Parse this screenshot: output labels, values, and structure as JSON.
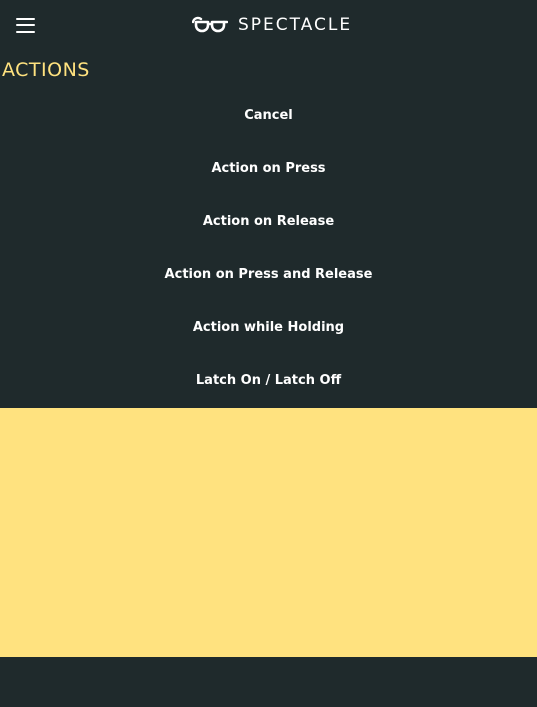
{
  "header": {
    "menu_icon": "hamburger-menu-icon",
    "logo_icon": "glasses-icon",
    "brand_name": "SPECTACLE"
  },
  "section": {
    "title": "ACTIONS"
  },
  "actions": [
    {
      "label": "Cancel"
    },
    {
      "label": "Action on Press"
    },
    {
      "label": "Action on Release"
    },
    {
      "label": "Action on Press and Release"
    },
    {
      "label": "Action while Holding"
    },
    {
      "label": "Latch On / Latch Off"
    }
  ],
  "colors": {
    "background": "#1f2a2c",
    "accent": "#ffe27f",
    "text": "#ffffff"
  }
}
